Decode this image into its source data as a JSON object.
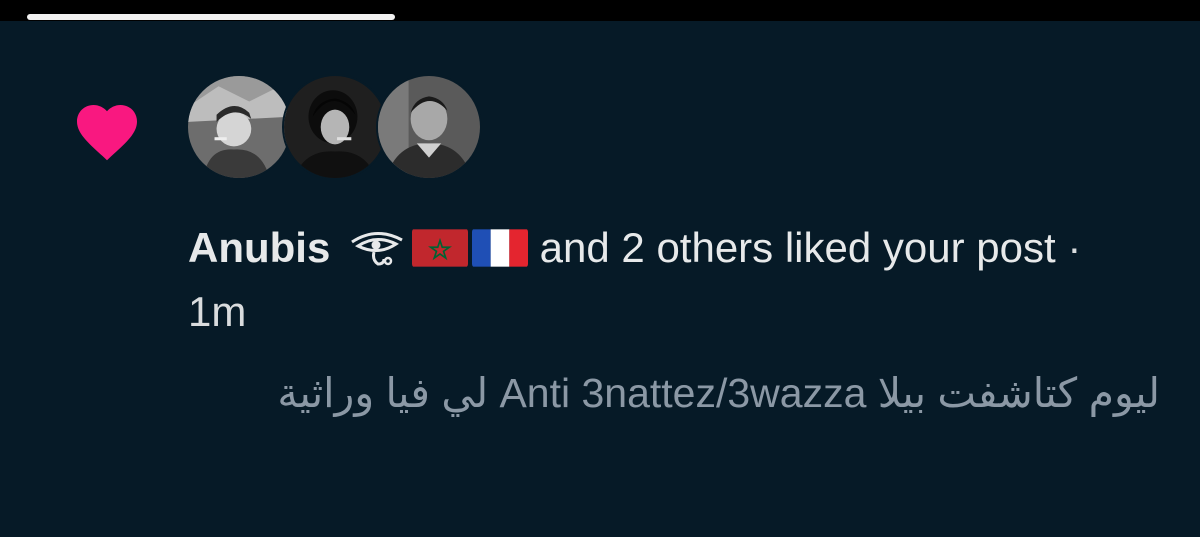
{
  "status_bar": {
    "progress": 1.0
  },
  "notification": {
    "type_icon": "heart-icon",
    "accent_color": "#f91880",
    "avatars": [
      "avatar-1",
      "avatar-2",
      "avatar-3"
    ],
    "actor_name": "Anubis",
    "actor_badges": [
      "eye-of-horus-icon",
      "morocco-flag-icon",
      "france-flag-icon"
    ],
    "action_text": " and 2 others liked your post",
    "separator": " · ",
    "timestamp": "1m"
  },
  "post": {
    "text": "ليوم كتاشفت بيلا Anti 3nattez/3wazza لي فيا وراثية"
  }
}
